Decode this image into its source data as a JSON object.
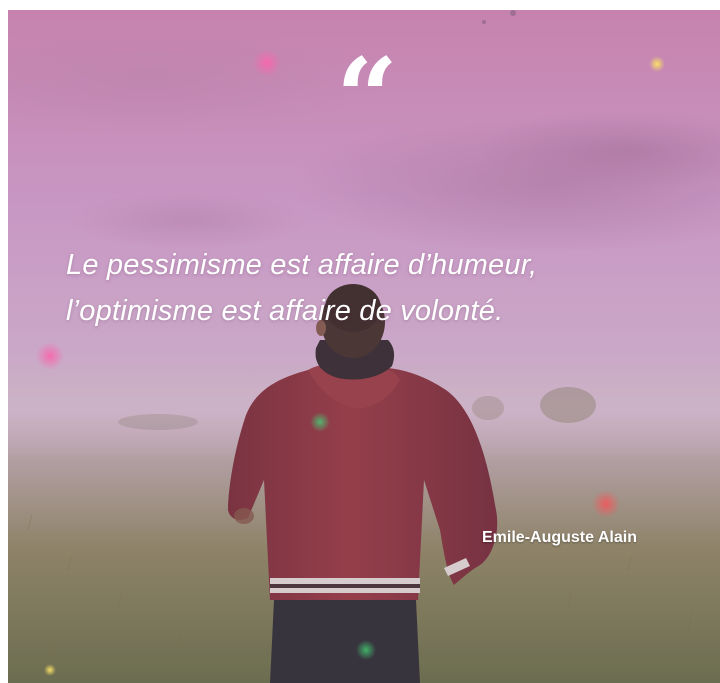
{
  "quote": {
    "mark": "“",
    "lines": [
      "Le pessimisme est affaire d’humeur,",
      "l’optimisme est affaire de volonté."
    ],
    "author": "Emile-Auguste Alain"
  },
  "image": {
    "subject": "man-in-red-jacket-facing-misty-field",
    "colors": {
      "sky_top": "#c78ab4",
      "sky_mid": "#c6a0c8",
      "haze": "#c7b2c2",
      "grass": "#7d7a52",
      "jacket": "#7f2c34",
      "text": "#ffffff"
    }
  }
}
